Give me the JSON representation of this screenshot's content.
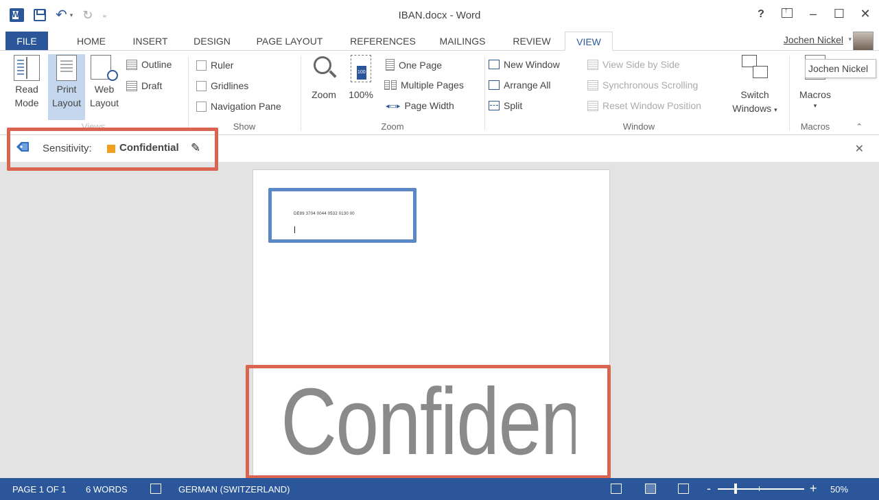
{
  "window": {
    "title": "IBAN.docx - Word",
    "controls": {
      "help": "?",
      "minimize": "–",
      "maximize": "☐",
      "close": "✕"
    }
  },
  "tabs": [
    "FILE",
    "HOME",
    "INSERT",
    "DESIGN",
    "PAGE LAYOUT",
    "REFERENCES",
    "MAILINGS",
    "REVIEW",
    "VIEW"
  ],
  "active_tab": "VIEW",
  "user": {
    "name": "Jochen Nickel"
  },
  "ribbon": {
    "views": {
      "label": "Views",
      "read_mode": [
        "Read",
        "Mode"
      ],
      "print_layout": [
        "Print",
        "Layout"
      ],
      "web_layout": [
        "Web",
        "Layout"
      ],
      "outline": "Outline",
      "draft": "Draft"
    },
    "show": {
      "label": "Show",
      "ruler": "Ruler",
      "gridlines": "Gridlines",
      "navigation_pane": "Navigation Pane"
    },
    "zoom": {
      "label": "Zoom",
      "zoom": "Zoom",
      "hundred": "100%",
      "one_page": "One Page",
      "multiple_pages": "Multiple Pages",
      "page_width": "Page Width"
    },
    "window": {
      "label": "Window",
      "new_window": "New Window",
      "arrange_all": "Arrange All",
      "split": "Split",
      "view_side_by_side": "View Side by Side",
      "synchronous_scrolling": "Synchronous Scrolling",
      "reset_window_position": "Reset Window Position",
      "switch_windows": [
        "Switch",
        "Windows"
      ]
    },
    "macros": {
      "label": "Macros",
      "macros": "Macros"
    }
  },
  "tooltip": "Jochen Nickel",
  "sensitivity": {
    "label": "Sensitivity:",
    "value": "Confidential",
    "swatch_color": "#f0a020"
  },
  "document": {
    "iban": "DE89 3704 0044 0532 0130 00",
    "watermark": "Confidential"
  },
  "statusbar": {
    "page": "PAGE 1 OF 1",
    "words": "6 WORDS",
    "language": "GERMAN (SWITZERLAND)",
    "zoom": "50%",
    "zoom_level": 0.5
  },
  "colors": {
    "accent": "#2b579a",
    "highlight_red": "#d9644f",
    "highlight_blue": "#5a87c6"
  }
}
